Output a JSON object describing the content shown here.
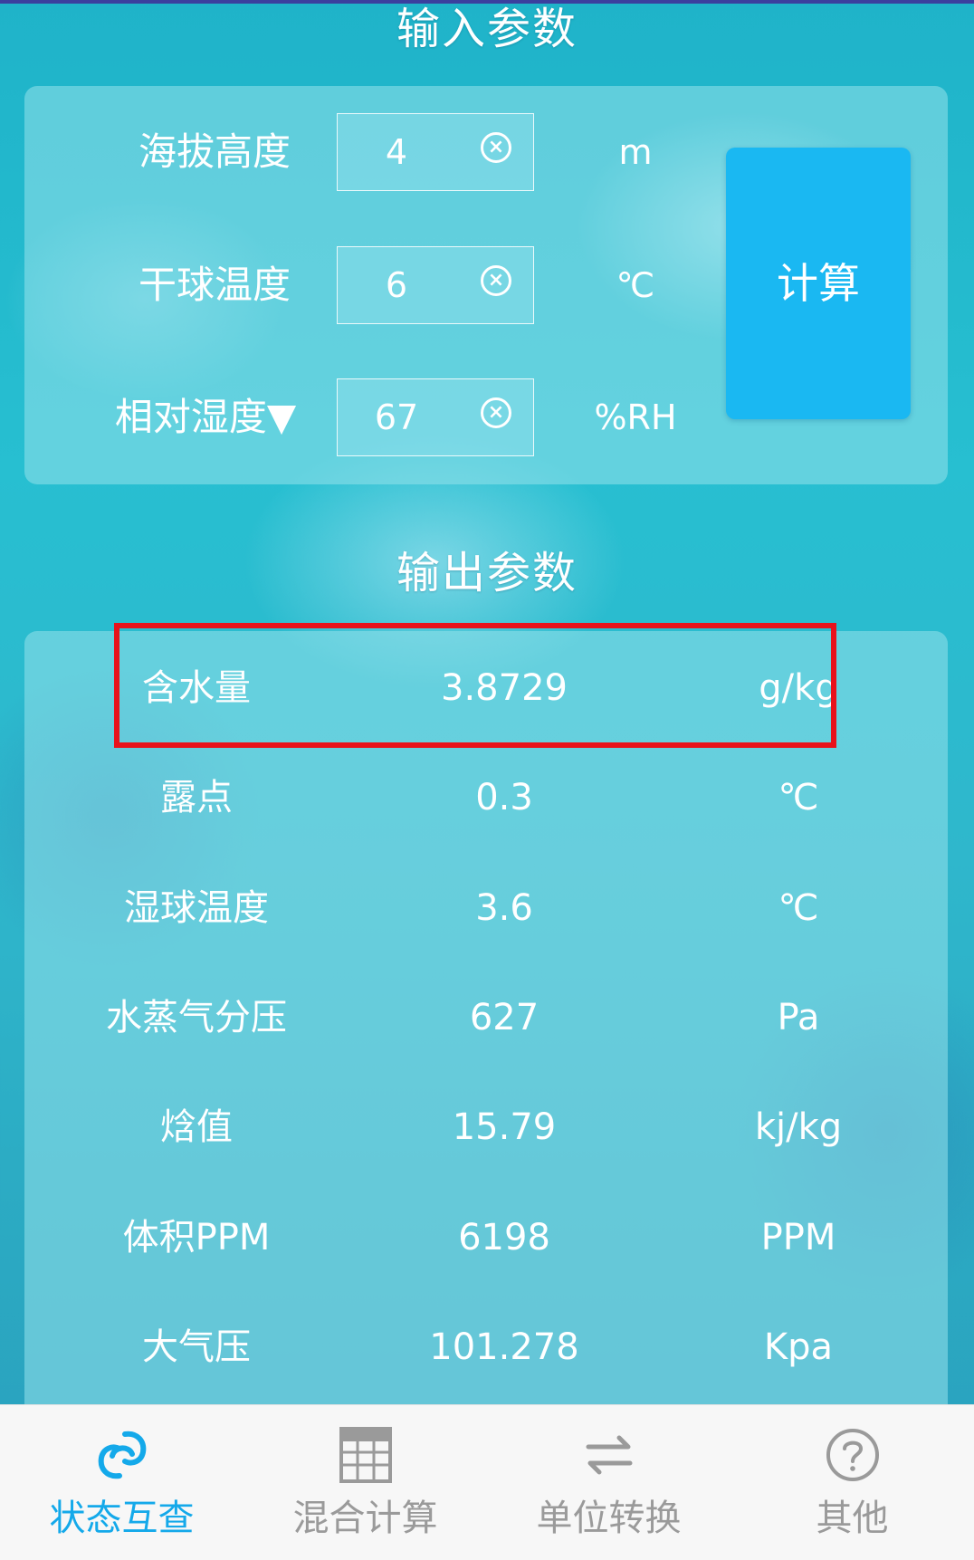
{
  "input_section": {
    "title": "输入参数",
    "fields": [
      {
        "label": "海拔高度",
        "value": "4",
        "unit": "m"
      },
      {
        "label": "干球温度",
        "value": "6",
        "unit": "℃"
      },
      {
        "label": "相对湿度▼",
        "value": "67",
        "unit": "%RH"
      }
    ],
    "calculate_label": "计算"
  },
  "output_section": {
    "title": "输出参数",
    "rows": [
      {
        "label": "含水量",
        "value": "3.8729",
        "unit": "g/kg"
      },
      {
        "label": "露点",
        "value": "0.3",
        "unit": "℃"
      },
      {
        "label": "湿球温度",
        "value": "3.6",
        "unit": "℃"
      },
      {
        "label": "水蒸气分压",
        "value": "627",
        "unit": "Pa"
      },
      {
        "label": "焓值",
        "value": "15.79",
        "unit": "kj/kg"
      },
      {
        "label": "体积PPM",
        "value": "6198",
        "unit": "PPM"
      },
      {
        "label": "大气压",
        "value": "101.278",
        "unit": "Kpa"
      }
    ]
  },
  "bottom_nav": {
    "items": [
      {
        "label": "状态互查",
        "icon": "link-loop-icon",
        "active": true
      },
      {
        "label": "混合计算",
        "icon": "calculator-grid-icon",
        "active": false
      },
      {
        "label": "单位转换",
        "icon": "swap-arrows-icon",
        "active": false
      },
      {
        "label": "其他",
        "icon": "help-circle-icon",
        "active": false
      }
    ]
  },
  "colors": {
    "accent": "#14a9ea",
    "button": "#1ab8f2",
    "highlight": "#e8121b",
    "inactive_nav": "#9a9a9a"
  }
}
